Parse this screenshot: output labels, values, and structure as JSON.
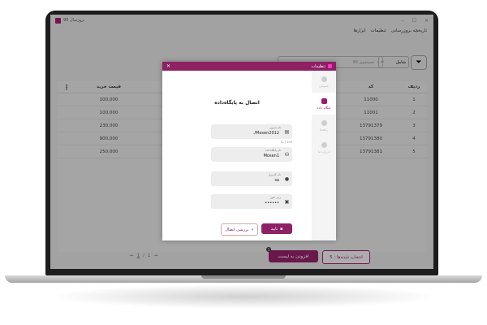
{
  "window": {
    "title": "پروژسال 90",
    "menu": [
      "تاریخچه بروزرسانی",
      "تنظیمات",
      "ابزارها"
    ]
  },
  "toolbar": {
    "select_value": "شامل",
    "search_placeholder": "جستجوی 90"
  },
  "table": {
    "headers": {
      "index": "ردیف",
      "code": "کد",
      "price": "قیمت خرید"
    },
    "rows": [
      {
        "index": "1",
        "code": "11000",
        "price": "100,000"
      },
      {
        "index": "2",
        "code": "11001",
        "price": "100,000"
      },
      {
        "index": "3",
        "code": "13791379",
        "price": "230,000"
      },
      {
        "index": "4",
        "code": "13791380",
        "price": "900,000"
      },
      {
        "index": "5",
        "code": "13791381",
        "price": "250,000"
      }
    ]
  },
  "footer": {
    "select_all": "انتخاب شده‌ها : 5",
    "add_to_list": "افزودن به لیست",
    "add_badge": "5",
    "pager": {
      "current": "1",
      "sep": "/",
      "total": "1"
    }
  },
  "dialog": {
    "title": "تنظیمات",
    "heading": "اتصال به پایگاه‌داده",
    "side": [
      {
        "label": "عمومی",
        "active": false
      },
      {
        "label": "پایگاه داده",
        "active": true
      },
      {
        "label": "راهنما",
        "active": false
      },
      {
        "label": "درباره ما",
        "active": false
      }
    ],
    "fields": {
      "server": {
        "label": "نام سرور",
        "value": "./Mosen2012"
      },
      "database": {
        "label": "نام پایگاه‌داده",
        "value": "Mosen1"
      },
      "user": {
        "label": "نام کاربری",
        "value": "sa"
      },
      "password": {
        "label": "رمز عبور",
        "value": "••••••"
      }
    },
    "counter": "11 / 100",
    "confirm": "تایید",
    "test": "بررسی اتصال"
  }
}
